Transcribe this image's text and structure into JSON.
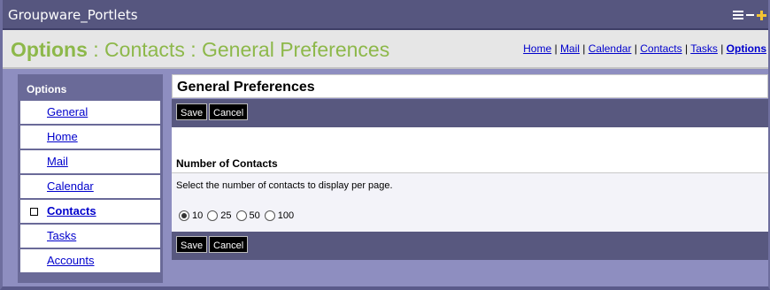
{
  "portlet": {
    "title": "Groupware_Portlets"
  },
  "heading": {
    "crumb_options": "Options",
    "crumb_rest": " : Contacts : General Preferences"
  },
  "top_links": [
    {
      "label": "Home"
    },
    {
      "label": "Mail"
    },
    {
      "label": "Calendar"
    },
    {
      "label": "Contacts"
    },
    {
      "label": "Tasks"
    },
    {
      "label": "Options"
    }
  ],
  "sidebar": {
    "title": "Options",
    "items": [
      {
        "label": "General"
      },
      {
        "label": "Home"
      },
      {
        "label": "Mail"
      },
      {
        "label": "Calendar"
      },
      {
        "label": "Contacts",
        "current": true
      },
      {
        "label": "Tasks"
      },
      {
        "label": "Accounts"
      }
    ]
  },
  "main": {
    "title": "General Preferences",
    "save_label": "Save",
    "cancel_label": "Cancel",
    "section_title": "Number of Contacts",
    "description": "Select the number of contacts to display per page.",
    "options": [
      {
        "label": "10",
        "selected": true
      },
      {
        "label": "25",
        "selected": false
      },
      {
        "label": "50",
        "selected": false
      },
      {
        "label": "100",
        "selected": false
      }
    ]
  },
  "colors": {
    "title_bar": "#56567f",
    "accent_green": "#8db84a",
    "link": "#0000cc"
  }
}
